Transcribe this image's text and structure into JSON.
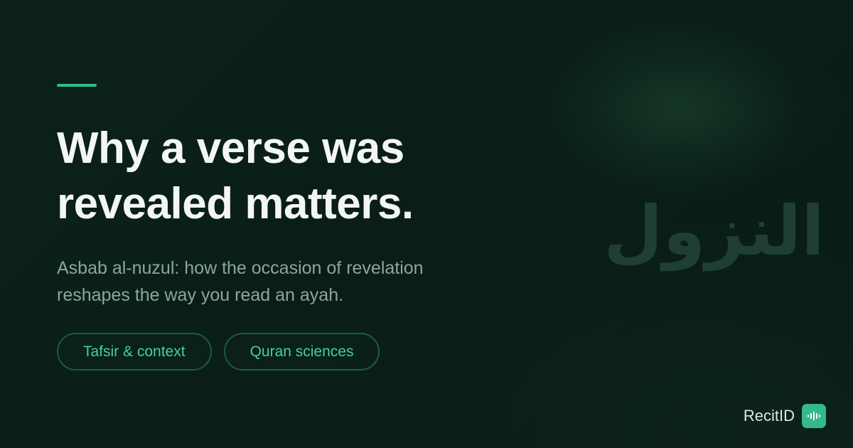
{
  "headline": {
    "line1": "Why a verse was",
    "line2": "revealed matters."
  },
  "subtitle": {
    "line1": "Asbab al-nuzul: how the occasion of revelation",
    "line2": "reshapes the way you read an ayah."
  },
  "tags": [
    {
      "label": "Tafsir & context"
    },
    {
      "label": "Quran sciences"
    }
  ],
  "background_text": "النزول",
  "brand": {
    "name": "RecitID",
    "logo_icon": "soundwave-icon"
  },
  "colors": {
    "accent": "#2fbf86",
    "tag_text": "#47d197",
    "logo_bg": "#35b98a"
  }
}
